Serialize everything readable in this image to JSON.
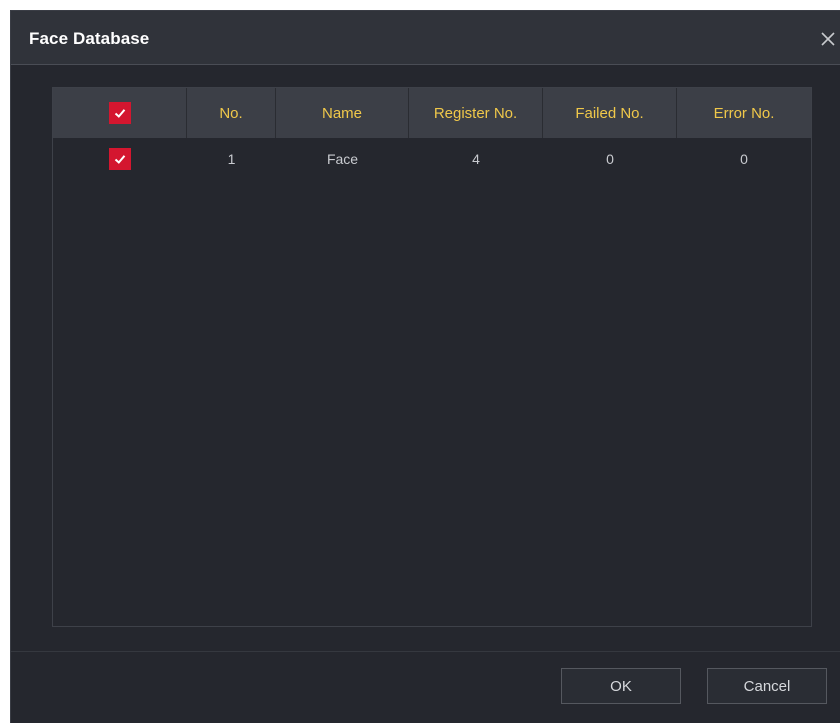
{
  "dialog": {
    "title": "Face Database",
    "close_icon": "close-icon"
  },
  "table": {
    "select_all_checked": true,
    "columns": [
      "No.",
      "Name",
      "Register No.",
      "Failed No.",
      "Error No."
    ],
    "rows": [
      {
        "checked": true,
        "no": "1",
        "name": "Face",
        "register_no": "4",
        "failed_no": "0",
        "error_no": "0"
      }
    ]
  },
  "buttons": {
    "ok_label": "OK",
    "cancel_label": "Cancel"
  },
  "colors": {
    "accent_red": "#d4162f",
    "header_text": "#f0c84a",
    "background": "#25272e"
  }
}
